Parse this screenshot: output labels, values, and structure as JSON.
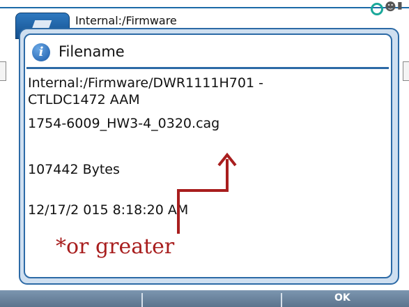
{
  "window": {
    "path_label": "Internal:/Firmware"
  },
  "dialog": {
    "title": "Filename",
    "lines": [
      "Internal:/Firmware/DWR1111H701 -",
      "CTLDC1472 AAM",
      "1754-6009_HW3-4_0320.cag",
      "107442 Bytes",
      "12/17/2 015  8:18:20 AM"
    ]
  },
  "annotation": {
    "text": "*or greater",
    "color": "#a81e1e"
  },
  "softkeys": {
    "ok_label": "OK"
  },
  "colors": {
    "accent": "#2c6aa6",
    "softkey_bar": "#6a849e"
  }
}
